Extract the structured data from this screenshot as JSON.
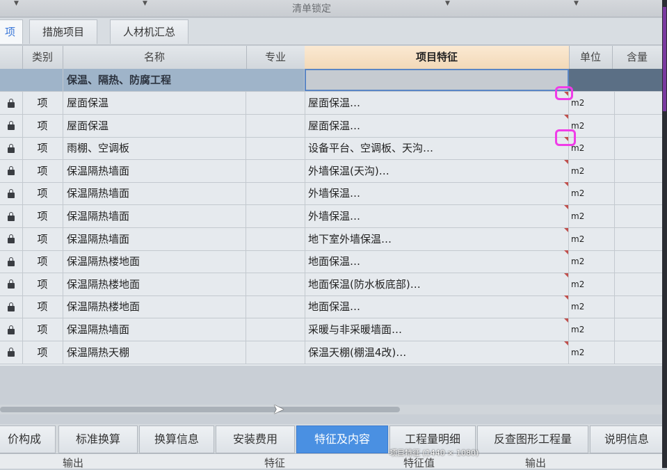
{
  "topbar": {
    "title": "清单锁定"
  },
  "tabs": [
    {
      "label": "项"
    },
    {
      "label": "措施项目"
    },
    {
      "label": "人材机汇总"
    }
  ],
  "columns": {
    "type": "类别",
    "name": "名称",
    "specialty": "专业",
    "feature": "项目特征",
    "unit": "单位",
    "content": "含量"
  },
  "group_row": {
    "name": "保温、隔热、防腐工程"
  },
  "rows": [
    {
      "type": "项",
      "name": "屋面保温",
      "feature": "屋面保温…",
      "unit": "m2"
    },
    {
      "type": "项",
      "name": "屋面保温",
      "feature": "屋面保温…",
      "unit": "m2"
    },
    {
      "type": "项",
      "name": "雨棚、空调板",
      "feature": "设备平台、空调板、天沟…",
      "unit": "m2"
    },
    {
      "type": "项",
      "name": "保温隔热墙面",
      "feature": "外墙保温(天沟)…",
      "unit": "m2"
    },
    {
      "type": "项",
      "name": "保温隔热墙面",
      "feature": "外墙保温…",
      "unit": "m2"
    },
    {
      "type": "项",
      "name": "保温隔热墙面",
      "feature": "外墙保温…",
      "unit": "m2"
    },
    {
      "type": "项",
      "name": "保温隔热墙面",
      "feature": "地下室外墙保温…",
      "unit": "m2"
    },
    {
      "type": "项",
      "name": "保温隔热楼地面",
      "feature": "地面保温…",
      "unit": "m2"
    },
    {
      "type": "项",
      "name": "保温隔热楼地面",
      "feature": "地面保温(防水板底部)…",
      "unit": "m2"
    },
    {
      "type": "项",
      "name": "保温隔热楼地面",
      "feature": "地面保温…",
      "unit": "m2"
    },
    {
      "type": "项",
      "name": "保温隔热墙面",
      "feature": "采暖与非采暖墙面…",
      "unit": "m2"
    },
    {
      "type": "项",
      "name": "保温隔热天棚",
      "feature": "保温天棚(棚温4改)…",
      "unit": "m2"
    }
  ],
  "bottom_tabs": [
    {
      "label": "价构成"
    },
    {
      "label": "标准换算"
    },
    {
      "label": "换算信息"
    },
    {
      "label": "安装费用"
    },
    {
      "label": "特征及内容"
    },
    {
      "label": "工程量明细"
    },
    {
      "label": "反查图形工程量"
    },
    {
      "label": "说明信息"
    }
  ],
  "bottom_row": {
    "left": "输出",
    "mid": "特征",
    "mid2": "特征值",
    "right": "输出"
  },
  "caption": "项目特征 (1440 × 1080)",
  "colors": {
    "accent": "#4a90e2",
    "group_row": "#9fb4c9",
    "feature_header": "#f2d9b8",
    "annotation": "#f03ce8"
  }
}
